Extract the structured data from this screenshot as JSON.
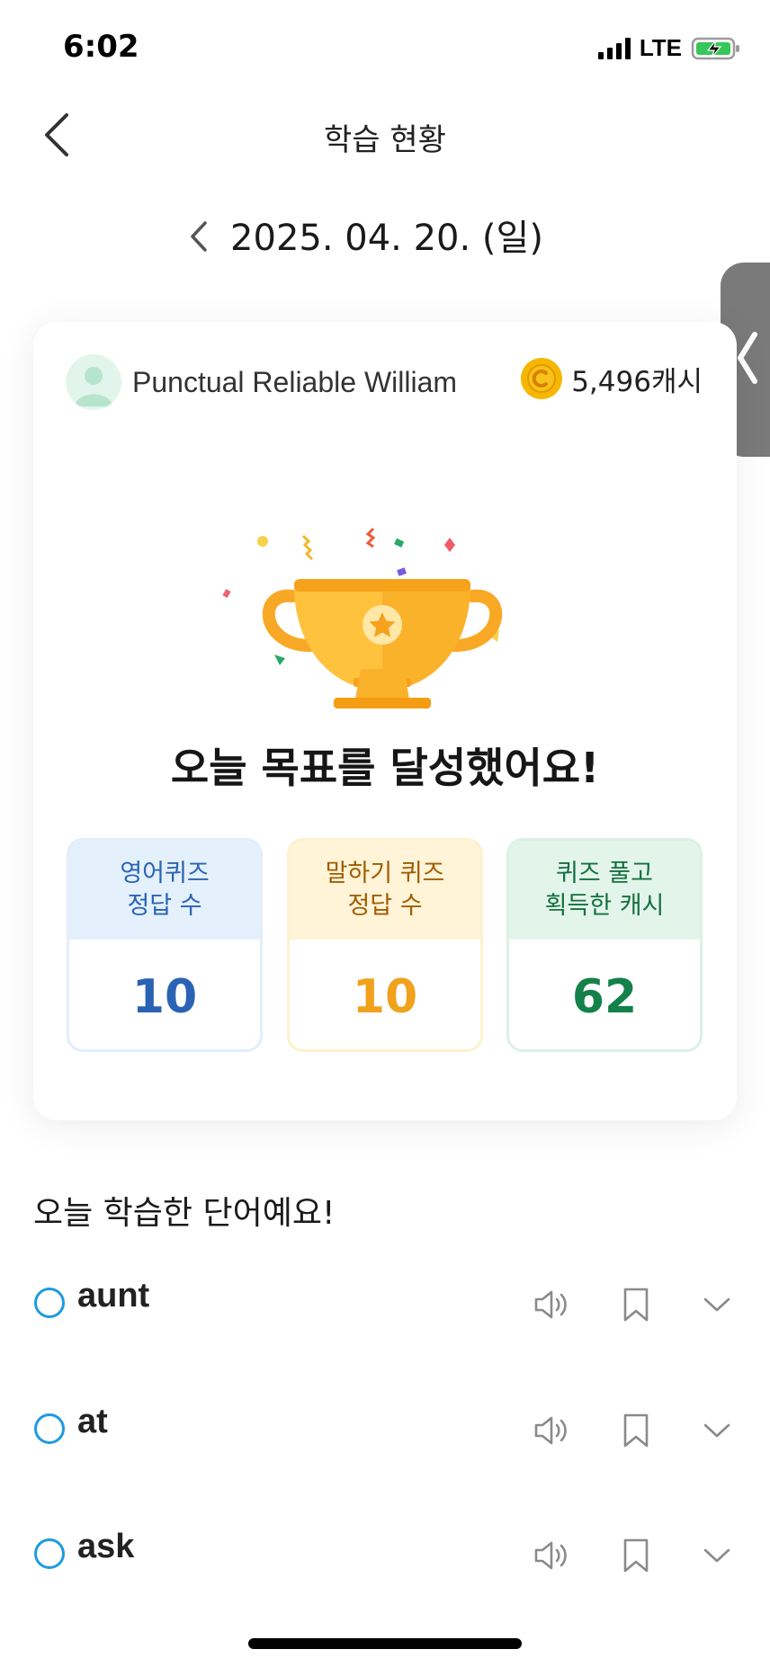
{
  "status_bar": {
    "time": "6:02",
    "network": "LTE"
  },
  "header": {
    "title": "학습 현황"
  },
  "date_nav": {
    "date": "2025. 04. 20. (일)"
  },
  "card": {
    "user_name": "Punctual Reliable William",
    "cash": "5,496캐시",
    "goal_message": "오늘 목표를 달성했어요!",
    "stats": [
      {
        "label_line1": "영어퀴즈",
        "label_line2": "정답 수",
        "value": "10"
      },
      {
        "label_line1": "말하기 퀴즈",
        "label_line2": "정답 수",
        "value": "10"
      },
      {
        "label_line1": "퀴즈 풀고",
        "label_line2": "획득한 캐시",
        "value": "62"
      }
    ]
  },
  "words_section": {
    "title": "오늘 학습한 단어예요!",
    "words": [
      {
        "word": "aunt"
      },
      {
        "word": "at"
      },
      {
        "word": "ask"
      }
    ]
  },
  "colors": {
    "accent_blue": "#2a63b4",
    "accent_orange": "#f0a21c",
    "accent_green": "#14814a",
    "check_blue": "#1e9be0",
    "trophy_gold": "#f9a825"
  },
  "icons": {
    "back": "chevron-left-icon",
    "date_prev": "chevron-left-icon",
    "side_handle": "chevron-left-icon",
    "coin": "coin-icon",
    "trophy": "trophy-icon",
    "speaker": "speaker-icon",
    "bookmark": "bookmark-icon",
    "expand": "chevron-down-icon"
  }
}
